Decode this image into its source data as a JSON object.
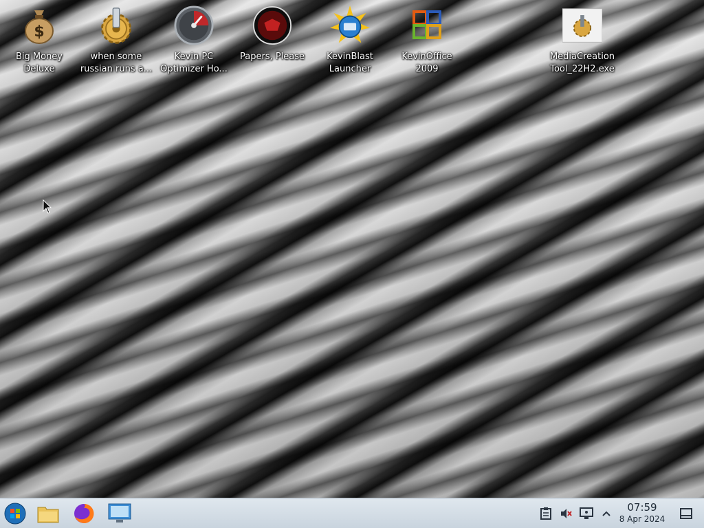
{
  "desktop_icons": [
    {
      "line1": "Big Money",
      "line2": "Deluxe",
      "icon": "money-bag-icon"
    },
    {
      "line1": "when some",
      "line2": "russian runs a...",
      "icon": "gear-icon"
    },
    {
      "line1": "Kevin PC",
      "line2": "Optimizer Ho...",
      "icon": "speedometer-icon"
    },
    {
      "line1": "Papers, Please",
      "line2": "",
      "icon": "papers-please-icon"
    },
    {
      "line1": "KevinBlast",
      "line2": "Launcher",
      "icon": "globe-sun-icon"
    },
    {
      "line1": "KevinOffice",
      "line2": "2009",
      "icon": "office-icon"
    },
    {
      "line1": "MediaCreation",
      "line2": "Tool_22H2.exe",
      "icon": "exe-gear-icon"
    }
  ],
  "taskbar": {
    "apps": [
      "start-button",
      "file-manager-icon",
      "firefox-icon",
      "remote-desktop-icon"
    ],
    "tray": [
      "clipboard-icon",
      "volume-muted-icon",
      "network-monitor-icon",
      "chevron-up-icon"
    ],
    "clock": {
      "time": "07:59",
      "date": "8 Apr 2024"
    },
    "show_desktop": "show-desktop-icon"
  }
}
